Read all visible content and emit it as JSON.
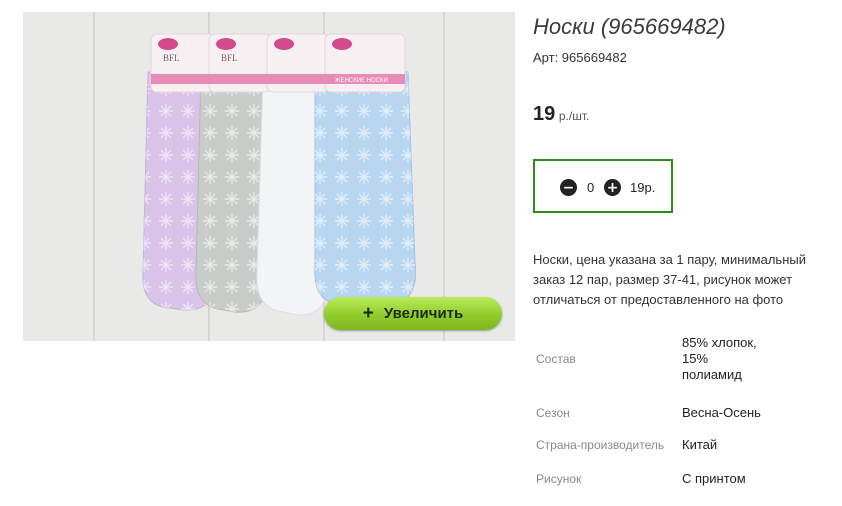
{
  "product": {
    "title": "Носки (965669482)",
    "article": "Арт: 965669482",
    "price_value": "19",
    "price_unit": "р./шт.",
    "zoom_button_label": "Увеличить",
    "zoom_button_icon": "plus-icon",
    "image_brand_text": "BFL",
    "image_package_text": "ЖЕНСКИЕ НОСКИ",
    "sock_colors": [
      "#d9c3e8",
      "#c9cdc9",
      "#f3f4f6",
      "#b9d6f0"
    ]
  },
  "cart": {
    "minus_icon": "minus-circle-icon",
    "plus_icon": "plus-circle-icon",
    "quantity": "0",
    "total": "19р."
  },
  "description": "Носки, цена указана за 1 пару, минимальный заказ 12 пар, размер 37-41, рисунок может отличаться от предоставленного на фото",
  "specs": [
    {
      "label": "Состав",
      "value": "85% хлопок, 15% полиамид"
    },
    {
      "label": "Сезон",
      "value": "Весна-Осень"
    },
    {
      "label": "Страна-производитель",
      "value": "Китай"
    },
    {
      "label": "Рисунок",
      "value": "С принтом"
    }
  ],
  "colors": {
    "accent_border": "#2f8a1c",
    "zoom_button": "#8fcc2a"
  }
}
